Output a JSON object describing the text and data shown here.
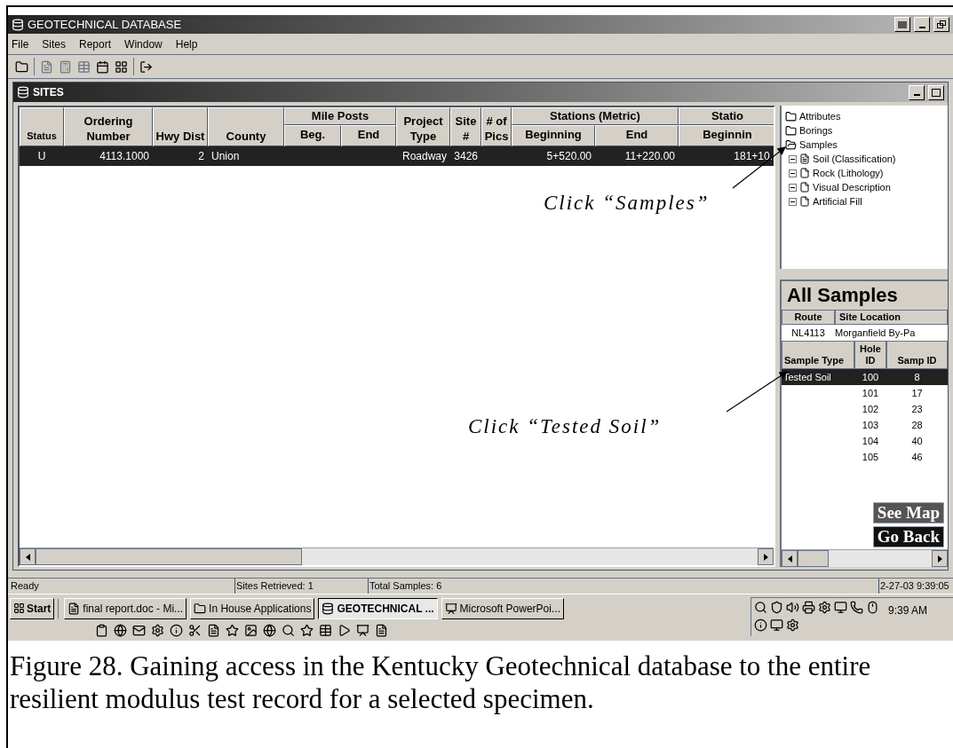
{
  "window": {
    "title": "GEOTECHNICAL DATABASE"
  },
  "menu": [
    "File",
    "Sites",
    "Report",
    "Window",
    "Help"
  ],
  "sites_window": {
    "title": "SITES"
  },
  "table": {
    "columns": [
      {
        "label": "Status"
      },
      {
        "label": "Ordering Number"
      },
      {
        "label": "Hwy Dist"
      },
      {
        "label": "County"
      },
      {
        "label": "Beg.",
        "group": "Mile Posts"
      },
      {
        "label": "End",
        "in_group": true
      },
      {
        "label": "Project Type"
      },
      {
        "label": "Site #"
      },
      {
        "label": "# of Pics"
      },
      {
        "label": "Beginning",
        "group": "Stations (Metric)"
      },
      {
        "label": "End",
        "in_group": true
      },
      {
        "label": "Beginnin",
        "group": "Statio"
      }
    ],
    "rows": [
      {
        "selected": true,
        "cells": [
          "U",
          "4113.1000",
          "2",
          "Union",
          "",
          "",
          "Roadway",
          "3426",
          "",
          "5+520.00",
          "11+220.00",
          "181+10."
        ]
      }
    ]
  },
  "tree": [
    {
      "label": "Attributes",
      "expanded": false
    },
    {
      "label": "Borings",
      "expanded": false
    },
    {
      "label": "Samples",
      "expanded": true,
      "children": [
        {
          "label": "Soil (Classification)",
          "kind": "form"
        },
        {
          "label": "Rock (Lithology)",
          "kind": "page"
        },
        {
          "label": "Visual Description",
          "kind": "page"
        },
        {
          "label": "Artificial Fill",
          "kind": "page"
        }
      ]
    }
  ],
  "annotations": [
    "Click “Samples”",
    "Click “Tested Soil”"
  ],
  "samples": {
    "title": "All Samples",
    "route_header": "Route",
    "site_header": "Site Location",
    "route": "NL4113",
    "site": "Morganfield By-Pa",
    "columns": [
      "Sample Type",
      "Hole ID",
      "Samp ID"
    ],
    "rows": [
      {
        "selected": true,
        "cells": [
          "Tested Soil",
          "100",
          "8"
        ]
      },
      {
        "selected": false,
        "cells": [
          "",
          "101",
          "17"
        ]
      },
      {
        "selected": false,
        "cells": [
          "",
          "102",
          "23"
        ]
      },
      {
        "selected": false,
        "cells": [
          "",
          "103",
          "28"
        ]
      },
      {
        "selected": false,
        "cells": [
          "",
          "104",
          "40"
        ]
      },
      {
        "selected": false,
        "cells": [
          "",
          "105",
          "46"
        ]
      }
    ],
    "buttons": [
      "See Map",
      "Go Back"
    ]
  },
  "status_bar": [
    "Ready",
    "Sites Retrieved: 1",
    "Total Samples: 6",
    "2-27-03 9:39:05"
  ],
  "taskbar": {
    "start": "Start",
    "tasks": [
      {
        "label": "final report.doc - Mi...",
        "selected": false
      },
      {
        "label": "In House Applications",
        "selected": false
      },
      {
        "label": "GEOTECHNICAL ...",
        "selected": true
      },
      {
        "label": "Microsoft PowerPoi...",
        "selected": false
      }
    ],
    "clock": "9:39 AM"
  },
  "caption": "Figure 28.  Gaining access in the Kentucky Geotechnical database to the entire resilient modulus test record for a selected specimen."
}
